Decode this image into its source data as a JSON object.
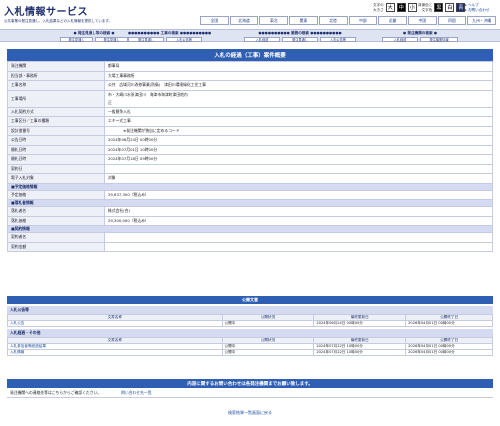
{
  "header": {
    "title": "入札情報サービス",
    "subtitle": "公共事業の発注見通し、入札結果などの入札情報を提供しています。",
    "font_size": {
      "label_line1": "文字の",
      "label_line2": "大きさ",
      "large": "大",
      "medium": "中",
      "small": "小"
    },
    "color": {
      "label_line1": "背景色と",
      "label_line2": "文字色",
      "white": "黒",
      "black": "白",
      "blue": "青"
    },
    "help": "ヘルプ",
    "contact": "お問い合わせ"
  },
  "regions": [
    "全国",
    "北海道",
    "東北",
    "関東",
    "北陸",
    "中部",
    "近畿",
    "中国",
    "四国",
    "九州・沖縄"
  ],
  "search": {
    "groups": [
      {
        "title": "● 発注見通し等の検索 ●",
        "buttons": [
          "発注見通し",
          "発注見通し"
        ]
      },
      {
        "title": "●●●●●●●●●● 工事の検索 ●●●●●●●●●●",
        "buttons": [
          "発注見通し",
          "入札公告等"
        ]
      },
      {
        "title": "●●●●●●●●●● 業務の検索 ●●●●●●●●●●",
        "buttons": [
          "入札経過",
          "発注見通し",
          "入札公告等"
        ]
      },
      {
        "title": "● 発注機関の検索 ●",
        "buttons": [
          "入札経過",
          "発注機関情報"
        ]
      }
    ]
  },
  "main": {
    "title": "入札の経過（工事）案件概要",
    "rows": [
      {
        "label": "発注機関",
        "value": "都事局"
      },
      {
        "label": "担当部・事務所",
        "value": "大場工事事務所"
      },
      {
        "label": "工事名称",
        "value": "公共　広域河川改修事業(防衛)　津田川環境緑化工住工事"
      },
      {
        "label": "工事場所",
        "value": "市・大崎川水系津田川　海津市海津町津田地内",
        "value2": "正",
        "tall": true
      },
      {
        "label": "入札契約方式",
        "value": "一般競争入札"
      },
      {
        "label": "工事区分／工事の種類",
        "value": "エキー式工事"
      },
      {
        "label": "設計書番号",
        "value": "　　　　※発注機関が独自に定めるコード"
      },
      {
        "label": "公告日時",
        "value": "2024年06月24日 00時00分"
      },
      {
        "label": "開札日時",
        "value": "2024年07月01日 10時00分"
      },
      {
        "label": "開札日時",
        "value": "2024年07月18日 09時00分"
      },
      {
        "label": "契約日",
        "value": ""
      },
      {
        "label": "電子入札対象",
        "value": "対象"
      }
    ],
    "sections": {
      "estimate": "■予定価格情報",
      "winner": "■落札者情報",
      "contract": "■契約情報"
    },
    "estimate_label": "予定価格",
    "estimate_value": "29,637,300（税込み）",
    "winner_rows": [
      {
        "label": "落札者名",
        "value": "株式会社(合)"
      },
      {
        "label": "落札価格",
        "value": "29,300,000（税込み）"
      }
    ],
    "contract_rows": [
      {
        "label": "契約者名",
        "value": ""
      },
      {
        "label": "契約金額",
        "value": ""
      }
    ]
  },
  "docs": {
    "title": "公開文書",
    "sections": [
      {
        "title": "入札公告等",
        "headers": [
          "文書名称",
          "公開状況",
          "最終更新日",
          "公開終了日"
        ],
        "rows": [
          [
            "入札公告",
            "公開中",
            "2024年06月24日 00時00分",
            "2026年04月01日 00時00分"
          ]
        ]
      },
      {
        "title": "入札経過・その他",
        "headers": [
          "文書名称",
          "公開状況",
          "最終更新日",
          "公開終了日"
        ],
        "rows": [
          [
            "入札参加者等経過結果",
            "公開中",
            "2024年07月22日 10時00分",
            "2026年04月01日 00時00分"
          ],
          [
            "入札情報",
            "公開中",
            "2024年07月22日 10時00分",
            "2026年04月01日 00時00分"
          ]
        ]
      }
    ]
  },
  "inquiry": {
    "title": "内容に関するお問い合わせは各発注機関までお願い致します。",
    "text": "発注機関への連絡先等はこちらからご確認ください。",
    "link": "問い合わせ先一覧"
  },
  "back_link": "検索結果一覧画面に戻る"
}
